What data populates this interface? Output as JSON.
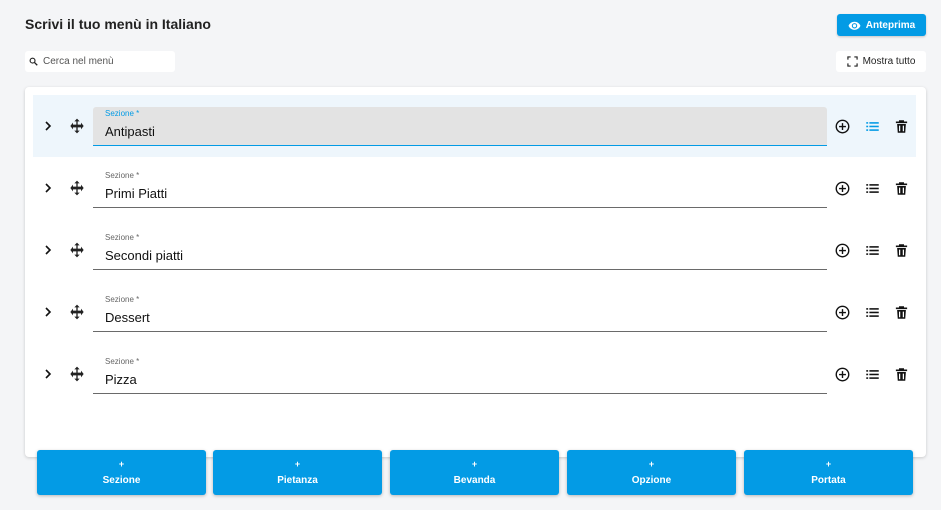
{
  "header": {
    "title": "Scrivi il tuo menù in Italiano",
    "preview_label": "Anteprima",
    "expand_label": "Mostra tutto"
  },
  "search": {
    "placeholder": "Cerca nel menù",
    "value": ""
  },
  "field_label": "Sezione *",
  "sections": [
    {
      "value": "Antipasti",
      "active": true
    },
    {
      "value": "Primi Piatti",
      "active": false
    },
    {
      "value": "Secondi piatti",
      "active": false
    },
    {
      "value": "Dessert",
      "active": false
    },
    {
      "value": "Pizza",
      "active": false
    }
  ],
  "add_buttons": [
    {
      "plus": "+",
      "label": "Sezione"
    },
    {
      "plus": "+",
      "label": "Pietanza"
    },
    {
      "plus": "+",
      "label": "Bevanda"
    },
    {
      "plus": "+",
      "label": "Opzione"
    },
    {
      "plus": "+",
      "label": "Portata"
    }
  ],
  "icons": {
    "preview": "eye-icon",
    "search": "search-icon",
    "expand": "fullscreen-icon",
    "expand_row": "chevron-right-icon",
    "drag": "move-icon",
    "add_item": "add-circle-icon",
    "list": "list-icon",
    "delete": "trash-icon"
  },
  "colors": {
    "accent": "#039be5",
    "background": "#f4f5f7",
    "active_row": "#eef6fc"
  }
}
